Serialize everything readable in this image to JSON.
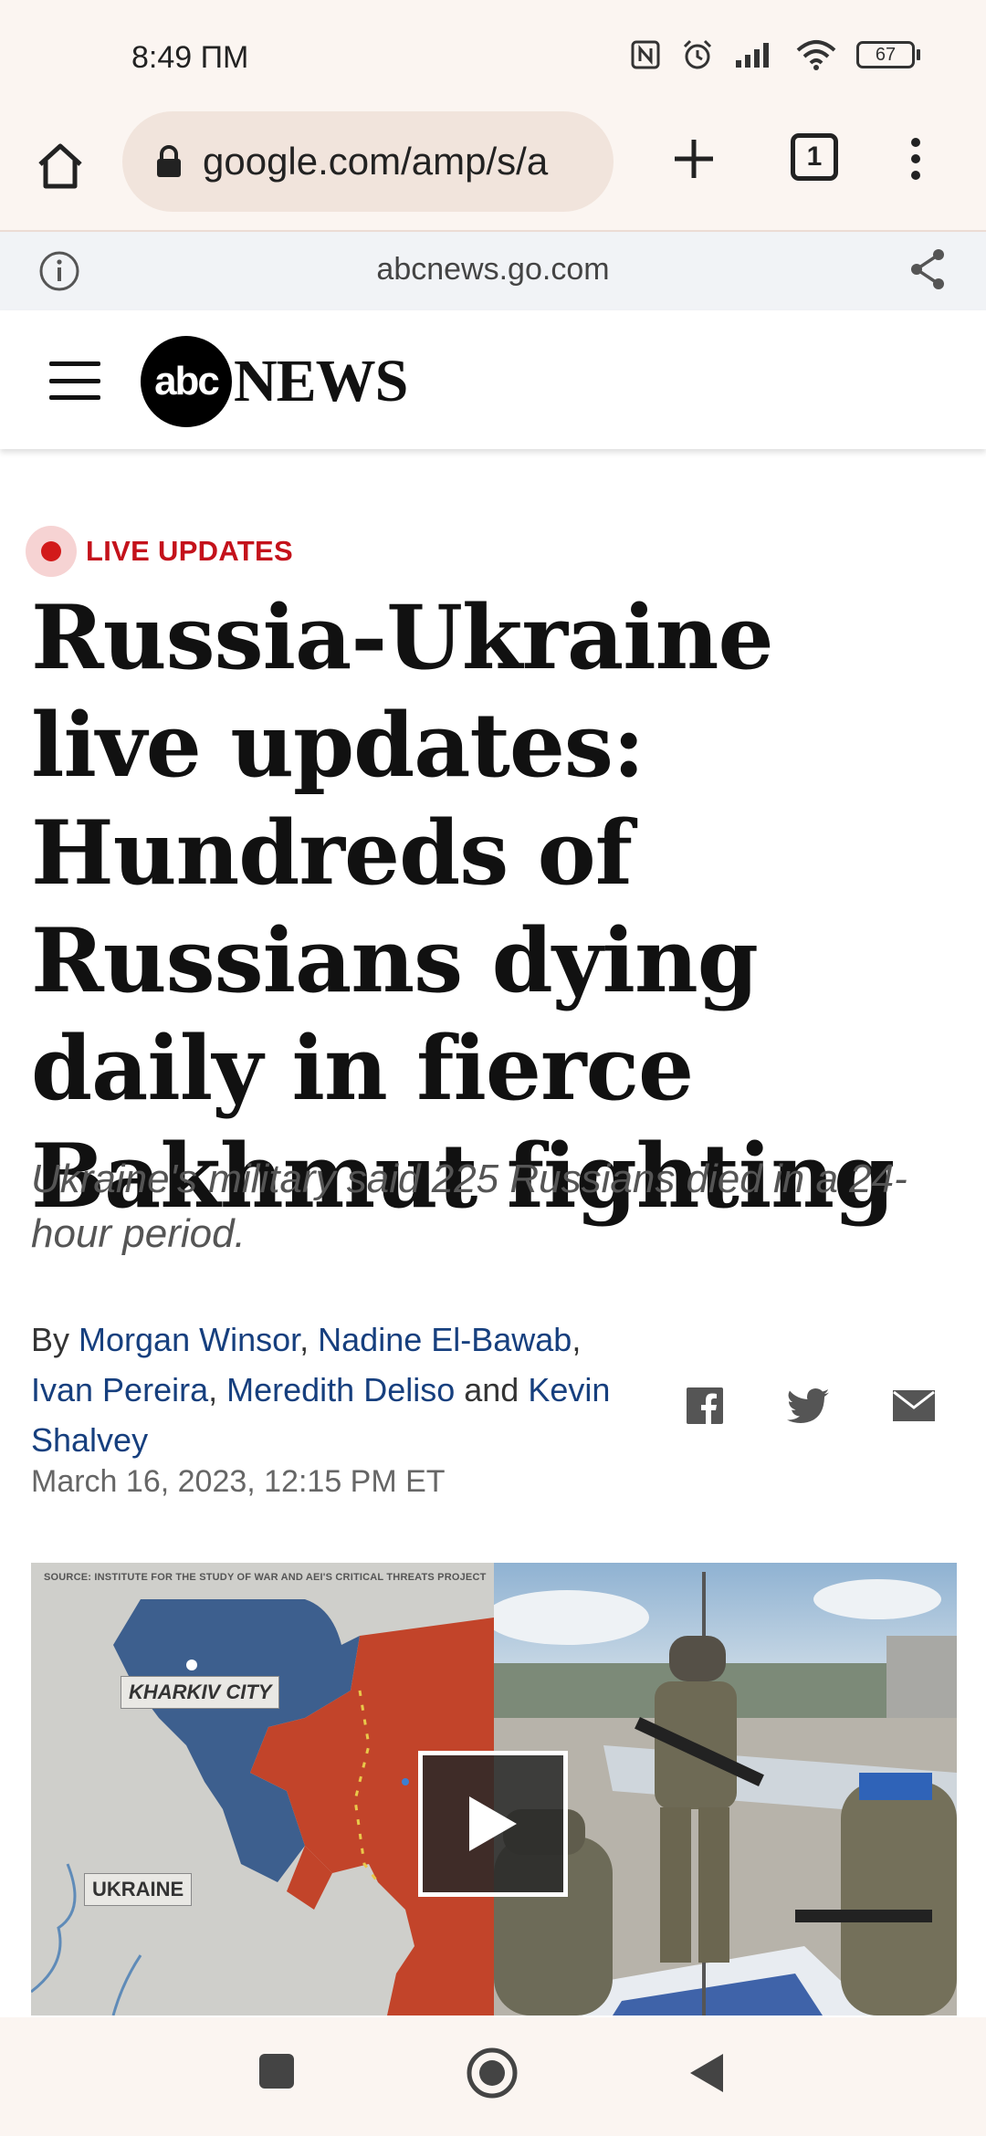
{
  "status_bar": {
    "time": "8:49 ПМ",
    "battery": "67",
    "icons": [
      "nfc-icon",
      "alarm-icon",
      "signal-icon",
      "wifi-icon",
      "battery-icon"
    ]
  },
  "browser": {
    "url": "google.com/amp/s/a",
    "tab_count": "1",
    "amp_domain": "abcnews.go.com",
    "icons": [
      "home-icon",
      "lock-icon",
      "plus-icon",
      "tabs-icon",
      "more-icon",
      "info-icon",
      "share-icon"
    ]
  },
  "site": {
    "logo_abc": "abc",
    "logo_news": "NEWS"
  },
  "article": {
    "badge": "LIVE UPDATES",
    "headline": "Russia-Ukraine live updates: Hundreds of Russians dying daily in fierce Bakhmut fighting",
    "subhead": "Ukraine's military said 225 Russians died in a 24-hour period.",
    "byline_prefix": "By",
    "authors": [
      "Morgan Winsor",
      "Nadine El-Bawab",
      "Ivan Pereira",
      "Meredith Deliso",
      "Kevin Shalvey"
    ],
    "separator": ",",
    "and": "and",
    "date": "March 16, 2023, 12:15 PM ET",
    "share_icons": [
      "facebook-icon",
      "twitter-icon",
      "email-icon"
    ]
  },
  "media": {
    "source": "SOURCE: INSTITUTE FOR THE STUDY OF WAR AND AEI'S CRITICAL THREATS PROJECT",
    "label_city": "KHARKIV CITY",
    "label_country": "UKRAINE"
  },
  "colors": {
    "live_red": "#c4121b",
    "author_blue": "#163f7e",
    "map_blue": "#3d5f8e",
    "map_red": "#c2442a"
  }
}
